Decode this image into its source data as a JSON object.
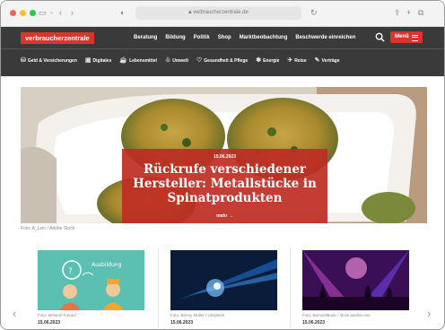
{
  "browser": {
    "url": "verbraucherzentrale.de"
  },
  "site": {
    "logo": "verbraucherzentrale",
    "nav": [
      "Beratung",
      "Bildung",
      "Politik",
      "Shop",
      "Marktbeobachtung",
      "Beschwerde einreichen"
    ],
    "menu_label": "Menü",
    "categories": [
      {
        "icon": "coins-icon",
        "glyph": "⛁",
        "label": "Geld & Versicherungen"
      },
      {
        "icon": "digital-icon",
        "glyph": "▣",
        "label": "Digitales"
      },
      {
        "icon": "food-icon",
        "glyph": "☕",
        "label": "Lebensmittel"
      },
      {
        "icon": "environment-icon",
        "glyph": "♧",
        "label": "Umwelt"
      },
      {
        "icon": "health-icon",
        "glyph": "♡",
        "label": "Gesundheit & Pflege"
      },
      {
        "icon": "energy-icon",
        "glyph": "✽",
        "label": "Energie"
      },
      {
        "icon": "travel-icon",
        "glyph": "✈",
        "label": "Reise"
      },
      {
        "icon": "contract-icon",
        "glyph": "✎",
        "label": "Verträge"
      }
    ]
  },
  "hero": {
    "date": "15.06.2023",
    "title": "Rückrufe verschiedener Hersteller: Metallstücke in Spinatprodukten",
    "more": "mehr →",
    "caption": "Foto: A_Lein / Adobe Stock"
  },
  "cards": [
    {
      "credit": "Foto: Melanie Freund",
      "date": "15.06.2023"
    },
    {
      "credit": "Foto: Benny Muller / Unsplash",
      "date": "15.06.2023"
    },
    {
      "credit": "Foto: BernardBodo / stock.adobe.com",
      "date": "15.06.2023"
    }
  ],
  "colors": {
    "brand_red": "#d7352e",
    "header_bg": "#3a3a3a"
  }
}
